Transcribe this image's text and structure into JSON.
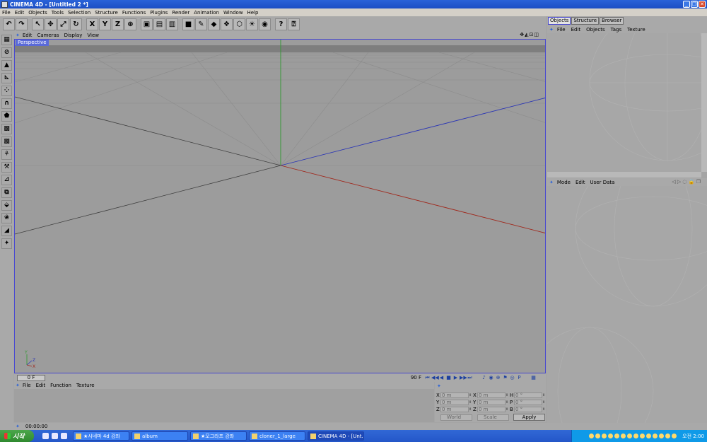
{
  "window": {
    "title": "CINEMA 4D - [Untitled 2 *]"
  },
  "menubar": [
    "File",
    "Edit",
    "Objects",
    "Tools",
    "Selection",
    "Structure",
    "Functions",
    "Plugins",
    "Render",
    "Animation",
    "Window",
    "Help"
  ],
  "toolbar": {
    "buttons": [
      {
        "name": "undo-button",
        "glyph": "↶"
      },
      {
        "name": "redo-button",
        "glyph": "↷"
      },
      {
        "name": "live-select-button",
        "glyph": "↖",
        "sep": true
      },
      {
        "name": "move-tool-button",
        "glyph": "✥"
      },
      {
        "name": "scale-tool-button",
        "glyph": "⤢"
      },
      {
        "name": "rotate-tool-button",
        "glyph": "↻"
      },
      {
        "name": "x-axis-lock-button",
        "glyph": "X",
        "sep": true
      },
      {
        "name": "y-axis-lock-button",
        "glyph": "Y"
      },
      {
        "name": "z-axis-lock-button",
        "glyph": "Z"
      },
      {
        "name": "coordinate-system-button",
        "glyph": "⊕"
      },
      {
        "name": "render-view-button",
        "glyph": "▣",
        "sep": true
      },
      {
        "name": "render-picture-viewer-button",
        "glyph": "▤"
      },
      {
        "name": "render-settings-button",
        "glyph": "▥"
      },
      {
        "name": "cube-object-button",
        "glyph": "■",
        "sep": true
      },
      {
        "name": "spline-tools-button",
        "glyph": "✎"
      },
      {
        "name": "nurbs-button",
        "glyph": "◆"
      },
      {
        "name": "array-tools-button",
        "glyph": "❖"
      },
      {
        "name": "deformer-button",
        "glyph": "⬡"
      },
      {
        "name": "scene-button",
        "glyph": "☀"
      },
      {
        "name": "camera-button",
        "glyph": "◉"
      },
      {
        "name": "help-pointer-button",
        "glyph": "?",
        "sep": true
      },
      {
        "name": "help-button",
        "glyph": "⍰"
      }
    ]
  },
  "left_palette": {
    "buttons": [
      {
        "name": "tool-palette-1",
        "glyph": "▦"
      },
      {
        "name": "tool-palette-2",
        "glyph": "⊘"
      },
      {
        "name": "model-mode-button",
        "glyph": "▲"
      },
      {
        "name": "object-axis-button",
        "glyph": "⊾"
      },
      {
        "name": "points-mode-button",
        "glyph": "⁘"
      },
      {
        "name": "edges-mode-button",
        "glyph": "∩"
      },
      {
        "name": "polygons-mode-button",
        "glyph": "⬟"
      },
      {
        "name": "texture-mode-button",
        "glyph": "▩"
      },
      {
        "name": "workplane-button",
        "glyph": "▩"
      },
      {
        "name": "animation-mode-button",
        "glyph": "⚘"
      },
      {
        "name": "inverse-kinematics-button",
        "glyph": "⚒"
      },
      {
        "name": "tweak-mode-button",
        "glyph": "⊿"
      },
      {
        "name": "snap-button",
        "glyph": "⧉"
      },
      {
        "name": "axis-tool-button",
        "glyph": "⬙"
      },
      {
        "name": "paint-tool-button",
        "glyph": "❀"
      },
      {
        "name": "sculpt-button",
        "glyph": "◢"
      },
      {
        "name": "magnet-button",
        "glyph": "✦"
      }
    ]
  },
  "viewport": {
    "menu": [
      "Edit",
      "Cameras",
      "Display",
      "View"
    ],
    "label": "Perspective",
    "nav_icons": "✥◭⊡◫",
    "axis_y": "Y",
    "axis_z": "Z",
    "axis_x": "X"
  },
  "timeline": {
    "current_frame": "0 F",
    "end_frame": "90 F",
    "controls": [
      "⏮",
      "◀◀",
      "◀",
      "■",
      "▶",
      "▶▶",
      "⏭",
      "",
      "♪",
      "◉",
      "⊕",
      "⚑",
      "◎",
      "P",
      "",
      "▦"
    ]
  },
  "material_manager": {
    "menu": [
      "File",
      "Edit",
      "Function",
      "Texture"
    ]
  },
  "coordinates": {
    "rows": [
      [
        {
          "l": "X",
          "v": "0 m"
        },
        {
          "l": "X",
          "v": "0 m"
        },
        {
          "l": "H",
          "v": "0 °"
        }
      ],
      [
        {
          "l": "Y",
          "v": "0 m"
        },
        {
          "l": "Y",
          "v": "0 m"
        },
        {
          "l": "P",
          "v": "0 °"
        }
      ],
      [
        {
          "l": "Z",
          "v": "0 m"
        },
        {
          "l": "Z",
          "v": "0 m"
        },
        {
          "l": "B",
          "v": "0 °"
        }
      ]
    ],
    "space": "World",
    "mode": "Scale",
    "apply": "Apply"
  },
  "status": {
    "time": "00:00:00"
  },
  "objects_panel": {
    "tabs": [
      "Objects",
      "Structure",
      "Browser"
    ],
    "menu": [
      "File",
      "Edit",
      "Objects",
      "Tags",
      "Texture"
    ]
  },
  "attributes_panel": {
    "menu": [
      "Mode",
      "Edit",
      "User Data"
    ]
  },
  "taskbar": {
    "start": "시작",
    "tasks": [
      {
        "label": "★시네마 4d 강좌",
        "active": false
      },
      {
        "label": "album",
        "active": false
      },
      {
        "label": "★모그라프 강좌",
        "active": false
      },
      {
        "label": "cloner_1_large",
        "active": false
      },
      {
        "label": "CINEMA 4D - [Unt...",
        "active": true
      }
    ],
    "clock": "오전 2:00"
  }
}
